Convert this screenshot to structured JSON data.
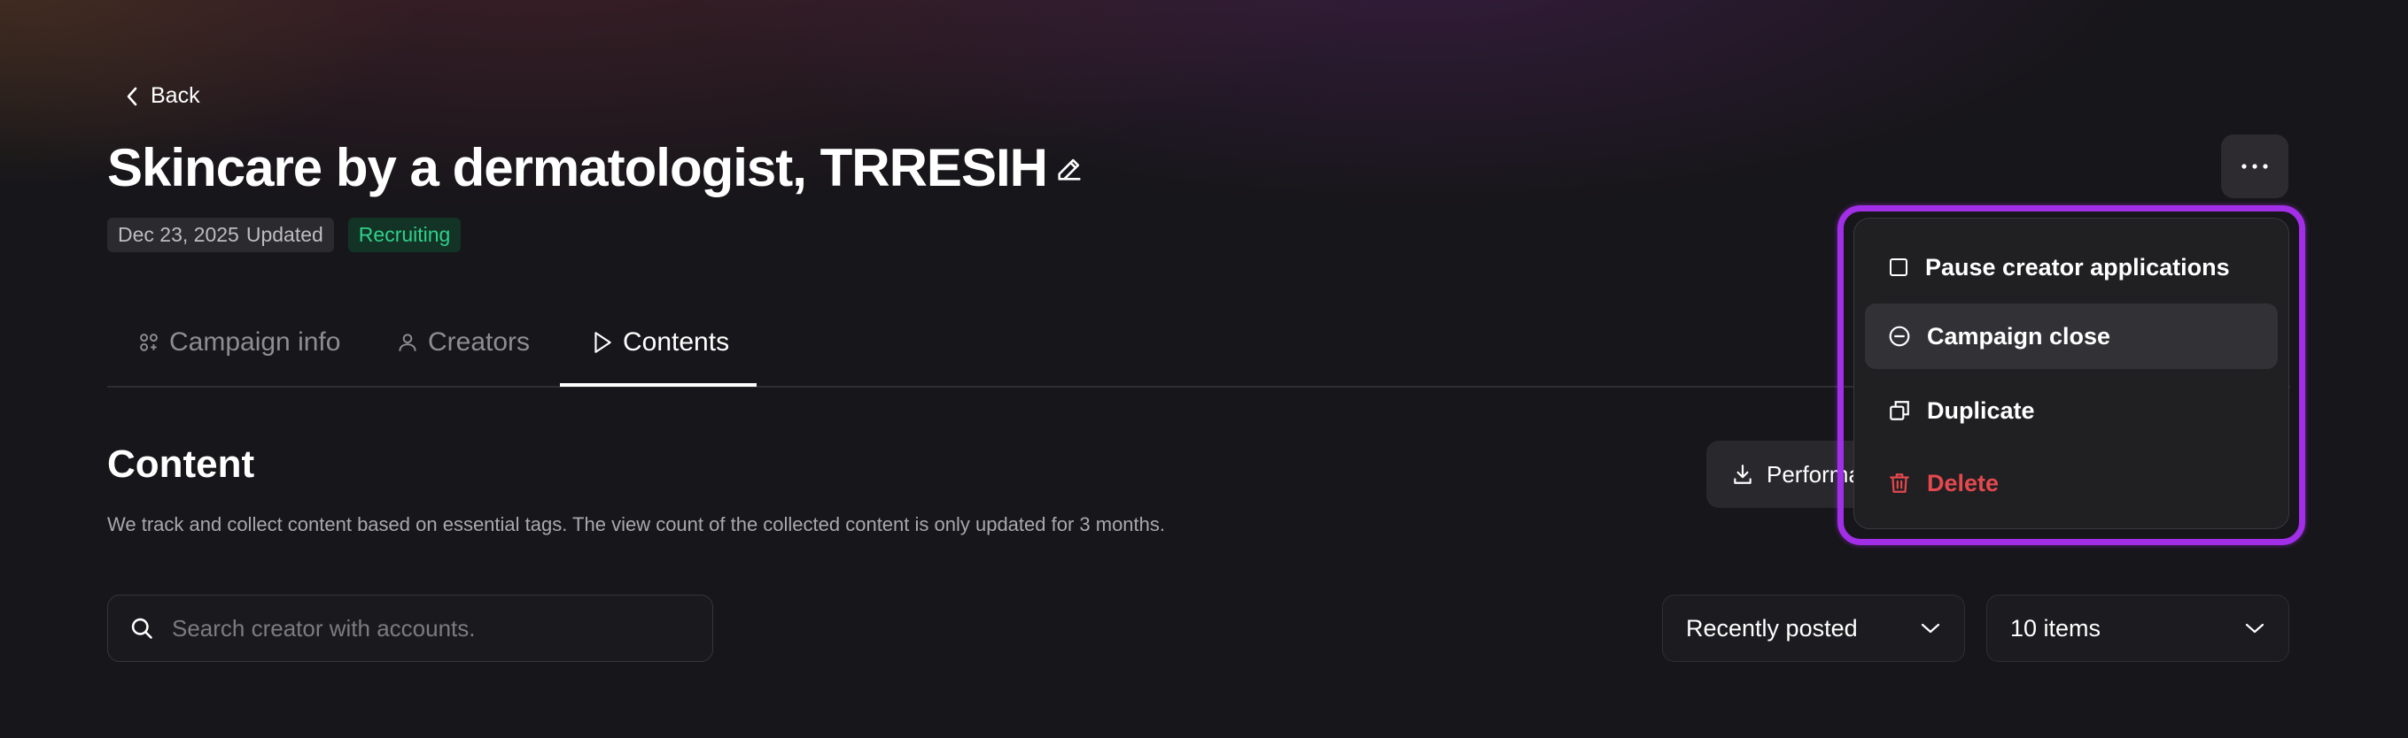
{
  "back": {
    "label": "Back"
  },
  "campaign": {
    "title": "Skincare by a dermatologist, TRRESIH",
    "date": "Dec 23, 2025",
    "updated_label": "Updated",
    "status": "Recruiting"
  },
  "tabs": [
    {
      "label": "Campaign info",
      "icon": "campaign-info-icon"
    },
    {
      "label": "Creators",
      "icon": "user-icon"
    },
    {
      "label": "Contents",
      "icon": "play-icon",
      "active": true
    }
  ],
  "content": {
    "title": "Content",
    "description": "We track and collect content based on essential tags. The view count of the collected content is only updated for 3 months.",
    "performance_button": "Performance"
  },
  "search": {
    "placeholder": "Search creator with accounts.",
    "value": ""
  },
  "sort_select": {
    "value": "Recently posted"
  },
  "page_size_select": {
    "value": "10 items"
  },
  "more_menu": {
    "items": [
      {
        "label": "Pause creator applications",
        "icon": "checkbox-icon"
      },
      {
        "label": "Campaign close",
        "icon": "minus-circle-icon",
        "hovered": true
      },
      {
        "label": "Duplicate",
        "icon": "duplicate-icon"
      },
      {
        "label": "Delete",
        "icon": "trash-icon",
        "danger": true
      }
    ]
  },
  "colors": {
    "background": "#17161a",
    "status_green": "#2fd08a",
    "danger": "#e5484d",
    "highlight": "#a22ee8"
  }
}
